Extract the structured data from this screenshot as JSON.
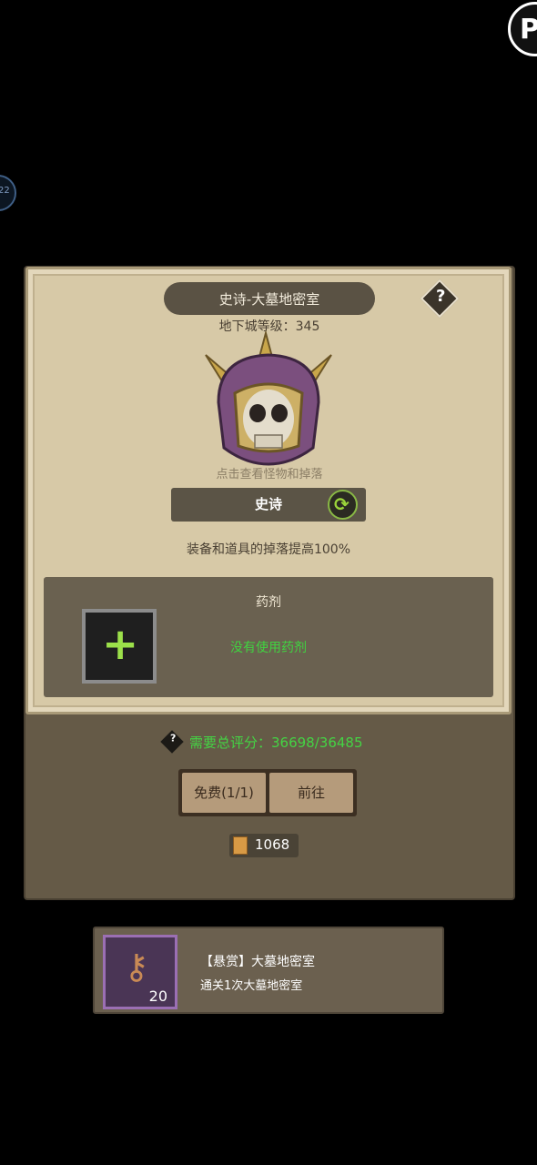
{
  "dialog": {
    "title": "史诗-大墓地密室",
    "help_icon": "question-icon",
    "dungeon_level": "地下城等级：345",
    "boss_hint": "点击查看怪物和掉落",
    "difficulty": "史诗",
    "switch_icon": "refresh-icon",
    "drop_bonus": "装备和道具的掉落提高100%",
    "potion": {
      "title": "药剂",
      "status": "没有使用药剂",
      "add_icon": "plus-icon"
    },
    "score": {
      "icon": "question-icon",
      "text": "需要总评分：36698/36485"
    },
    "buttons": {
      "free": "免费(1/1)",
      "go": "前往"
    },
    "currency": {
      "icon": "scroll-icon",
      "value": "1068"
    }
  },
  "bounty": {
    "title": "【悬赏】大墓地密室",
    "desc": "通关1次大墓地密室",
    "key_icon": "key-icon",
    "key_count": "20"
  },
  "corner": {
    "side_badge": "22"
  },
  "colors": {
    "parchment": "#d7c9a7",
    "panel": "#655a47",
    "green_text": "#44d444",
    "button": "#b59b7b"
  }
}
